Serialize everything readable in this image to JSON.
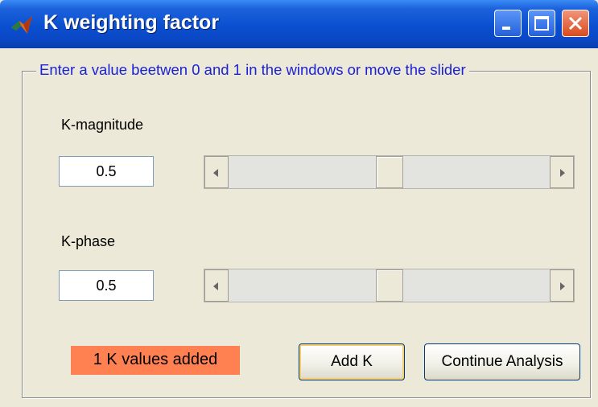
{
  "window": {
    "title": "K weighting factor",
    "icon": "matlab-icon",
    "controls": [
      "minimize-icon",
      "maximize-icon",
      "close-icon"
    ]
  },
  "panel": {
    "title": "Enter a value beetwen 0 and 1 in the windows or move the slider"
  },
  "magnitude": {
    "label": "K-magnitude",
    "value": "0.5",
    "slider_value": 0.5
  },
  "phase": {
    "label": "K-phase",
    "value": "0.5",
    "slider_value": 0.5
  },
  "status": {
    "text": "1 K values added",
    "color": "#FF8152"
  },
  "buttons": {
    "add_k": "Add K",
    "continue": "Continue Analysis"
  }
}
